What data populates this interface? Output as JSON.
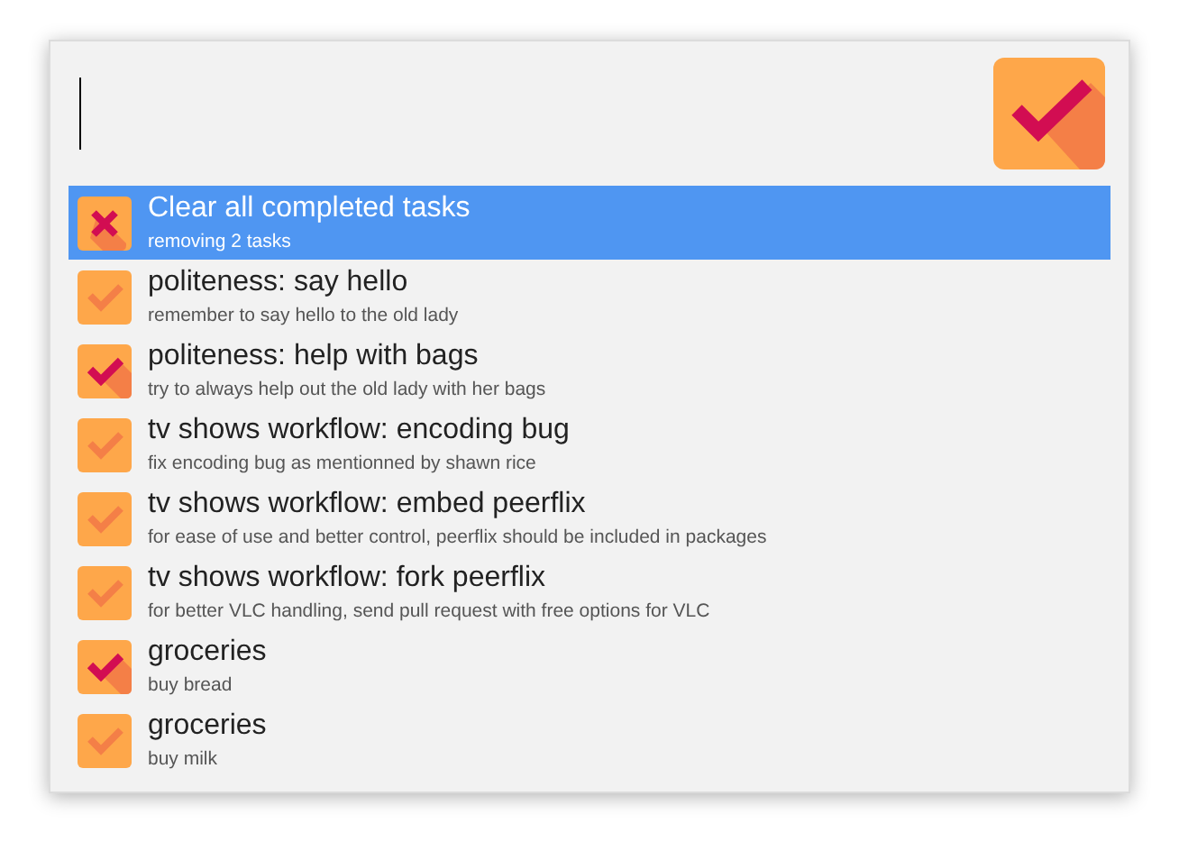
{
  "results": [
    {
      "kind": "action",
      "title": "Clear all completed tasks",
      "subtitle": "removing 2 tasks",
      "selected": true
    },
    {
      "kind": "task",
      "done": false,
      "title": "politeness: say hello",
      "subtitle": "remember to say hello to the old lady",
      "selected": false
    },
    {
      "kind": "task",
      "done": true,
      "title": "politeness: help with bags",
      "subtitle": "try to always help out the old lady with her bags",
      "selected": false
    },
    {
      "kind": "task",
      "done": false,
      "title": "tv shows workflow: encoding bug",
      "subtitle": "fix encoding bug as mentionned by shawn rice",
      "selected": false
    },
    {
      "kind": "task",
      "done": false,
      "title": "tv shows workflow: embed peerflix",
      "subtitle": "for ease of use and better control, peerflix should be included in packages",
      "selected": false
    },
    {
      "kind": "task",
      "done": false,
      "title": "tv shows workflow: fork peerflix",
      "subtitle": "for better VLC handling, send pull request with free options for VLC",
      "selected": false
    },
    {
      "kind": "task",
      "done": true,
      "title": "groceries",
      "subtitle": "buy bread",
      "selected": false
    },
    {
      "kind": "task",
      "done": false,
      "title": "groceries",
      "subtitle": "buy milk",
      "selected": false
    }
  ]
}
